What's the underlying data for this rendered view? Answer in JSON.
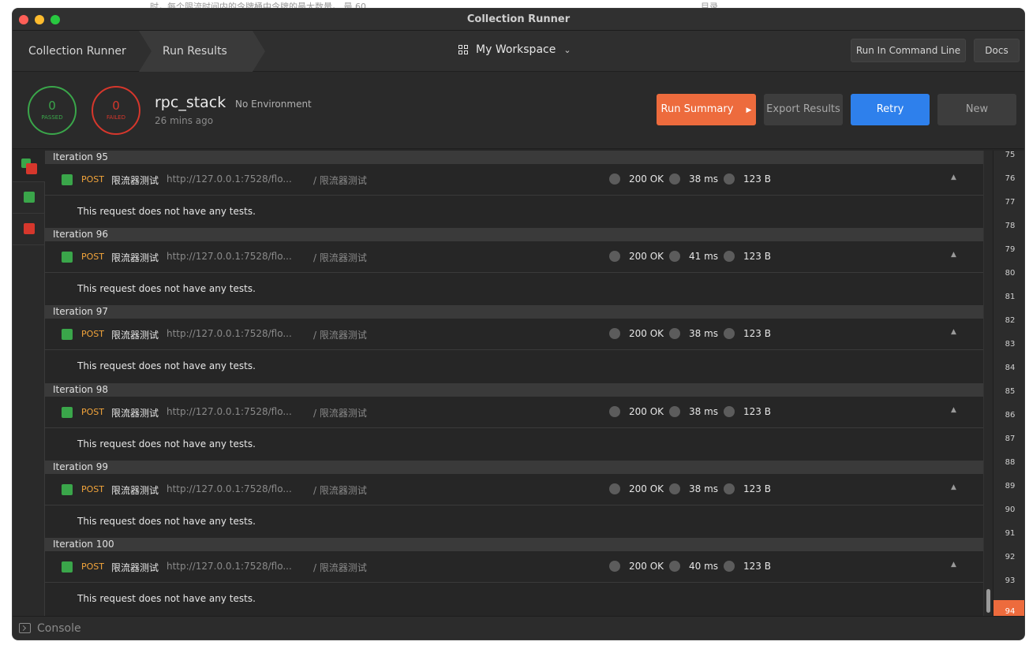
{
  "bg": {
    "left": "时，每个限流时间内的令牌桶中令牌的最大数量。 最 60",
    "right": "目录"
  },
  "window": {
    "title": "Collection Runner"
  },
  "nav": {
    "crumb_runner": "Collection Runner",
    "crumb_results": "Run Results",
    "workspace": "My Workspace",
    "run_cli": "Run In Command Line",
    "docs": "Docs"
  },
  "summary": {
    "passed_count": "0",
    "passed_label": "PASSED",
    "failed_count": "0",
    "failed_label": "FAILED",
    "collection": "rpc_stack",
    "environment": "No Environment",
    "time_ago": "26 mins ago",
    "run_summary": "Run Summary",
    "export": "Export Results",
    "retry": "Retry",
    "new": "New"
  },
  "colors": {
    "passed": "#3aa64a",
    "failed": "#d6372c",
    "accent": "#ed6b3d",
    "primary": "#2e80ec"
  },
  "iterations": [
    {
      "title": "Iteration 95",
      "method": "POST",
      "name": "限流器测试",
      "url": "http://127.0.0.1:7528/flo...",
      "path": "/ 限流器测试",
      "status": "200 OK",
      "time": "38 ms",
      "size": "123 B",
      "tests": "This request does not have any tests."
    },
    {
      "title": "Iteration 96",
      "method": "POST",
      "name": "限流器测试",
      "url": "http://127.0.0.1:7528/flo...",
      "path": "/ 限流器测试",
      "status": "200 OK",
      "time": "41 ms",
      "size": "123 B",
      "tests": "This request does not have any tests."
    },
    {
      "title": "Iteration 97",
      "method": "POST",
      "name": "限流器测试",
      "url": "http://127.0.0.1:7528/flo...",
      "path": "/ 限流器测试",
      "status": "200 OK",
      "time": "38 ms",
      "size": "123 B",
      "tests": "This request does not have any tests."
    },
    {
      "title": "Iteration 98",
      "method": "POST",
      "name": "限流器测试",
      "url": "http://127.0.0.1:7528/flo...",
      "path": "/ 限流器测试",
      "status": "200 OK",
      "time": "38 ms",
      "size": "123 B",
      "tests": "This request does not have any tests."
    },
    {
      "title": "Iteration 99",
      "method": "POST",
      "name": "限流器测试",
      "url": "http://127.0.0.1:7528/flo...",
      "path": "/ 限流器测试",
      "status": "200 OK",
      "time": "38 ms",
      "size": "123 B",
      "tests": "This request does not have any tests."
    },
    {
      "title": "Iteration 100",
      "method": "POST",
      "name": "限流器测试",
      "url": "http://127.0.0.1:7528/flo...",
      "path": "/ 限流器测试",
      "status": "200 OK",
      "time": "40 ms",
      "size": "123 B",
      "tests": "This request does not have any tests."
    }
  ],
  "minimap": [
    "75",
    "76",
    "77",
    "78",
    "79",
    "80",
    "81",
    "82",
    "83",
    "84",
    "85",
    "86",
    "87",
    "88",
    "89",
    "90",
    "91",
    "92",
    "93",
    "94"
  ],
  "minimap_active": "94",
  "status": {
    "console": "Console"
  }
}
